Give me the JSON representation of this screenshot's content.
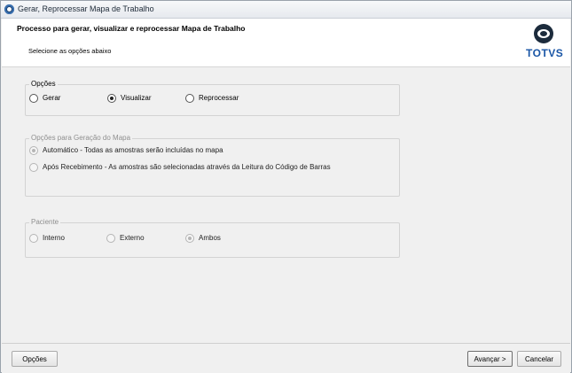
{
  "window": {
    "title": "Gerar, Reprocessar Mapa de Trabalho",
    "icon": "totvs-app-icon"
  },
  "header": {
    "title": "Processo para gerar, visualizar e reprocessar Mapa de Trabalho",
    "subtitle": "Selecione as opções abaixo",
    "logo_text": "TOTVS"
  },
  "groups": {
    "opcoes": {
      "legend": "Opções",
      "options": [
        {
          "label": "Gerar",
          "checked": false
        },
        {
          "label": "Visualizar",
          "checked": true
        },
        {
          "label": "Reprocessar",
          "checked": false
        }
      ]
    },
    "geracao": {
      "legend": "Opções para Geração do Mapa",
      "options": [
        {
          "label": "Automático - Todas as amostras serão incluídas no mapa",
          "checked": true
        },
        {
          "label": "Após Recebimento - As amostras são selecionadas através da Leitura do Código de Barras",
          "checked": false
        }
      ]
    },
    "paciente": {
      "legend": "Paciente",
      "options": [
        {
          "label": "Interno",
          "checked": false
        },
        {
          "label": "Externo",
          "checked": false
        },
        {
          "label": "Ambos",
          "checked": true
        }
      ]
    }
  },
  "footer": {
    "options_button": "Opções",
    "next_button": "Avançar >",
    "cancel_button": "Cancelar"
  }
}
